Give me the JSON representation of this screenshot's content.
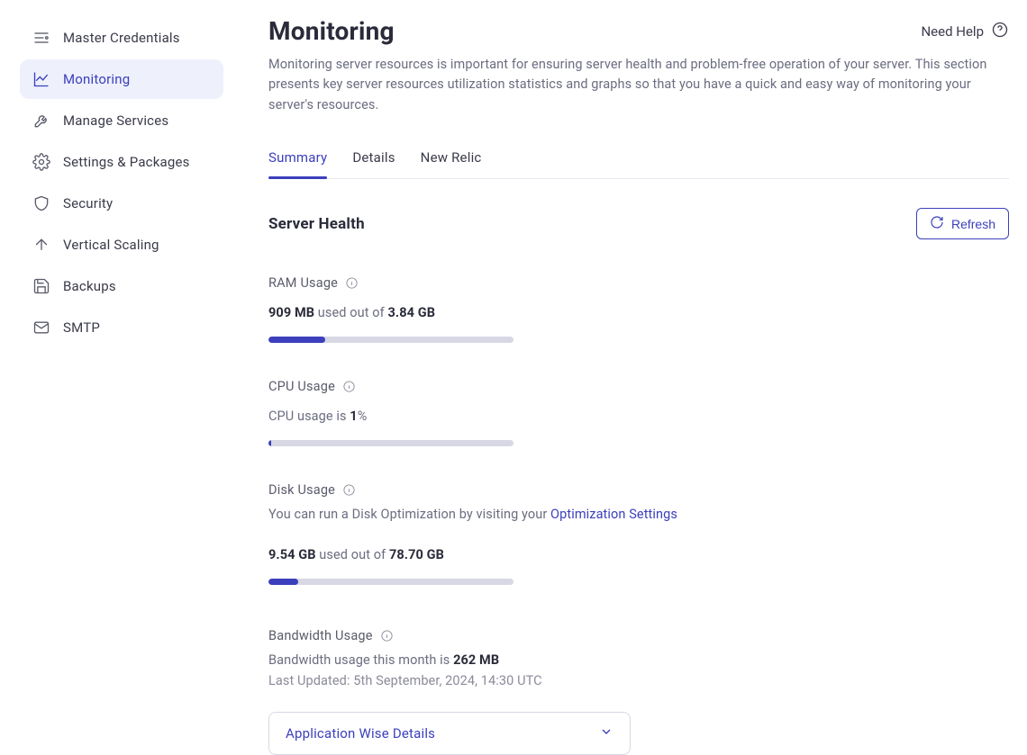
{
  "sidebar": {
    "items": [
      {
        "label": "Master Credentials",
        "icon": "menu-icon"
      },
      {
        "label": "Monitoring",
        "icon": "chart-icon"
      },
      {
        "label": "Manage Services",
        "icon": "wrench-icon"
      },
      {
        "label": "Settings & Packages",
        "icon": "gear-icon"
      },
      {
        "label": "Security",
        "icon": "shield-icon"
      },
      {
        "label": "Vertical Scaling",
        "icon": "arrow-up-icon"
      },
      {
        "label": "Backups",
        "icon": "save-icon"
      },
      {
        "label": "SMTP",
        "icon": "mail-icon"
      }
    ],
    "active_index": 1
  },
  "header": {
    "title": "Monitoring",
    "help_label": "Need Help",
    "description": "Monitoring server resources is important for ensuring server health and problem-free operation of your server. This section presents key server resources utilization statistics and graphs so that you have a quick and easy way of monitoring your server's resources."
  },
  "tabs": [
    {
      "label": "Summary"
    },
    {
      "label": "Details"
    },
    {
      "label": "New Relic"
    }
  ],
  "active_tab": 0,
  "section": {
    "title": "Server Health",
    "refresh_label": "Refresh"
  },
  "ram": {
    "label": "RAM Usage",
    "used": "909 MB",
    "middle": " used out of ",
    "total": "3.84 GB",
    "percent": 23
  },
  "cpu": {
    "label": "CPU Usage",
    "text_prefix": "CPU usage is ",
    "value": "1",
    "text_suffix": "%",
    "percent": 1
  },
  "disk": {
    "label": "Disk Usage",
    "hint_prefix": "You can run a Disk Optimization by visiting your ",
    "hint_link": "Optimization Settings",
    "used": "9.54 GB",
    "middle": " used out of ",
    "total": "78.70 GB",
    "percent": 12
  },
  "bandwidth": {
    "label": "Bandwidth Usage",
    "text_prefix": "Bandwidth usage this month is ",
    "value": "262 MB",
    "updated": "Last Updated: 5th September, 2024, 14:30 UTC",
    "select_label": "Application Wise Details"
  }
}
